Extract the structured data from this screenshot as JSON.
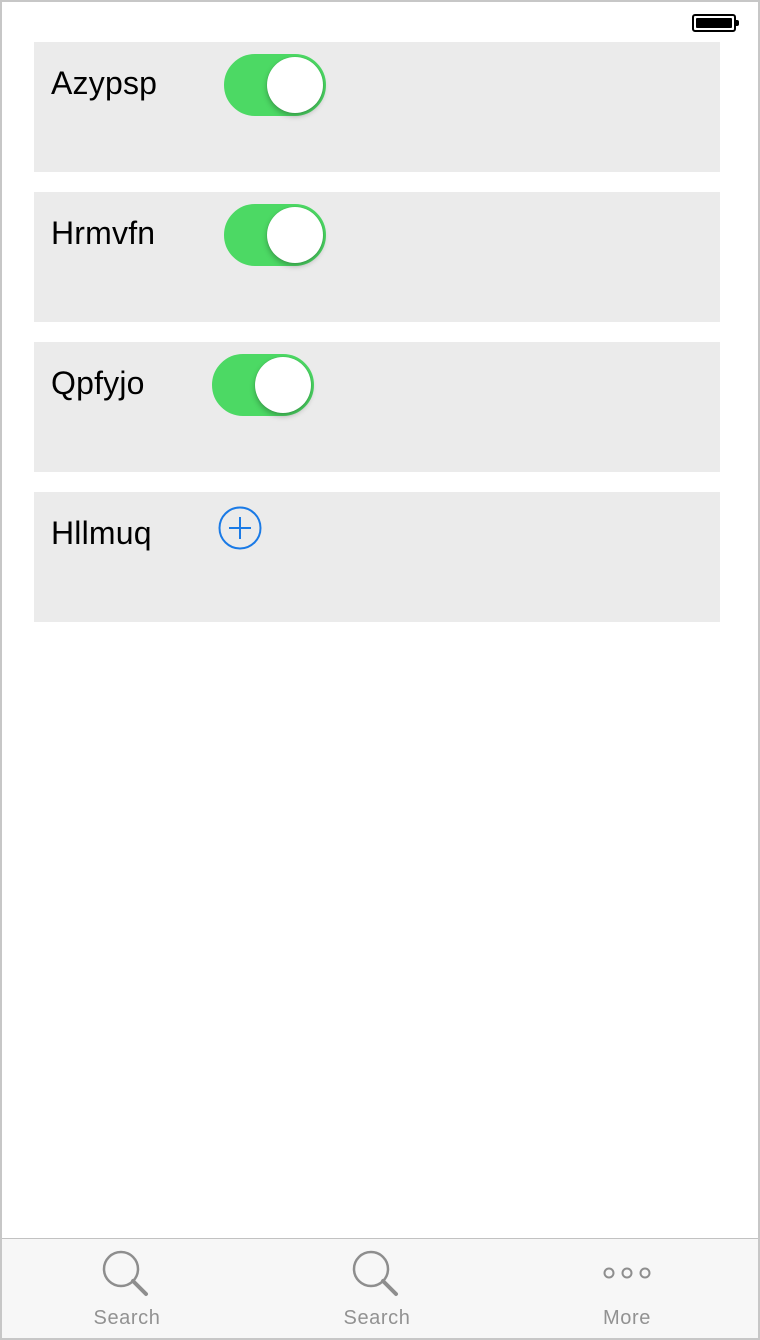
{
  "rows": [
    {
      "label": "Azypsp",
      "control": "switch",
      "on": true
    },
    {
      "label": "Hrmvfn",
      "control": "switch",
      "on": true
    },
    {
      "label": "Qpfyjo",
      "control": "switch",
      "on": true
    },
    {
      "label": "Hllmuq",
      "control": "add-icon"
    }
  ],
  "tab_bar": {
    "tabs": [
      {
        "label": "Search",
        "icon": "search-icon"
      },
      {
        "label": "Search",
        "icon": "search-icon"
      },
      {
        "label": "More",
        "icon": "more-icon"
      }
    ]
  },
  "colors": {
    "switch_on": "#4cd964",
    "accent": "#1a7ae6",
    "row_bg": "#ebebeb",
    "tab_icon": "#8e8e8e"
  }
}
